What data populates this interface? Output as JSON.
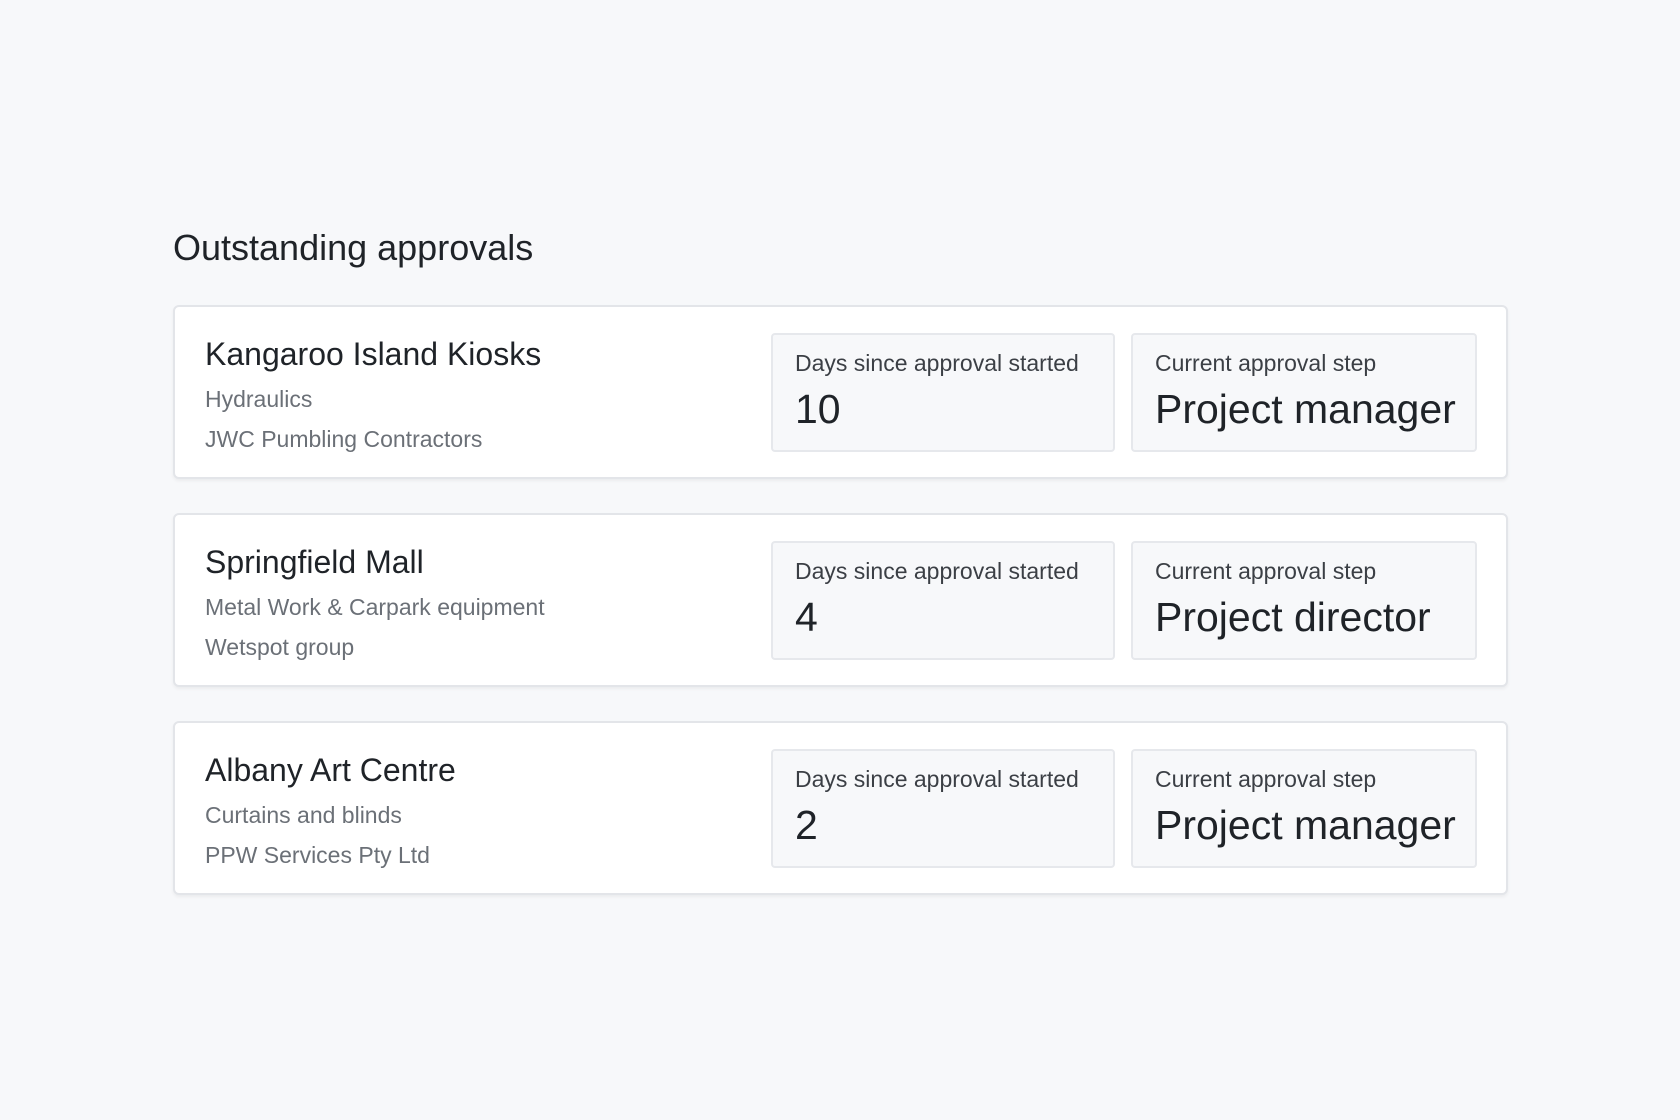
{
  "header": {
    "title": "Outstanding approvals"
  },
  "approvals": [
    {
      "project": "Kangaroo Island Kiosks",
      "trade": "Hydraulics",
      "contractor": "JWC Pumbling Contractors",
      "days_label": "Days since approval started",
      "days_value": "10",
      "step_label": "Current approval step",
      "step_value": "Project manager"
    },
    {
      "project": "Springfield Mall",
      "trade": "Metal Work & Carpark equipment",
      "contractor": "Wetspot group",
      "days_label": "Days since approval started",
      "days_value": "4",
      "step_label": "Current approval step",
      "step_value": "Project director"
    },
    {
      "project": "Albany Art Centre",
      "trade": "Curtains and blinds",
      "contractor": "PPW Services Pty Ltd",
      "days_label": "Days since approval started",
      "days_value": "2",
      "step_label": "Current approval step",
      "step_value": "Project manager"
    }
  ]
}
